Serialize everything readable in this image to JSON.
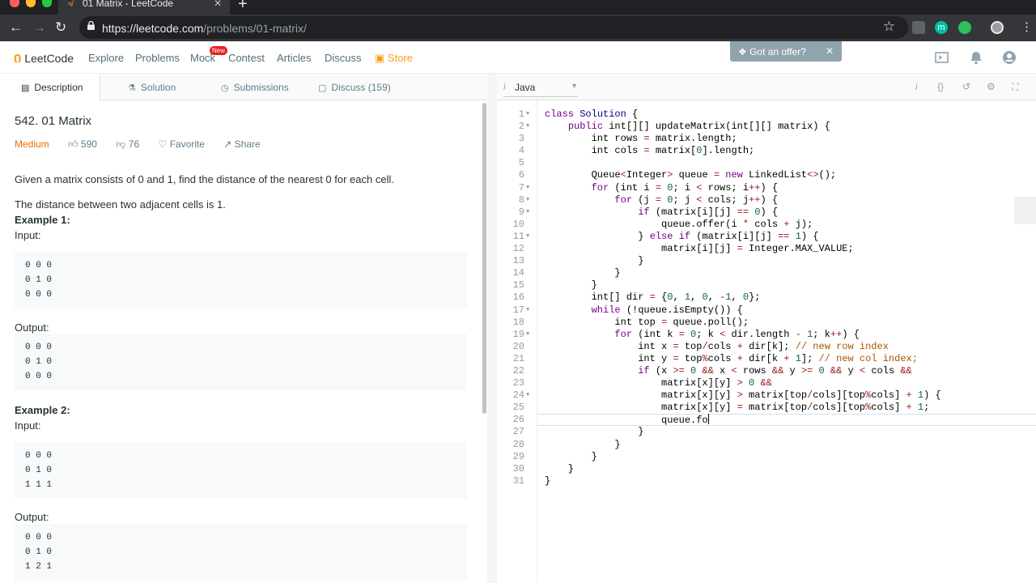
{
  "browser": {
    "tab_title": "01 Matrix - LeetCode",
    "url_host": "https://leetcode.com",
    "url_path": "/problems/01-matrix/",
    "extension_initial": "m"
  },
  "nav": {
    "brand": "LeetCode",
    "links": [
      "Explore",
      "Problems",
      "Mock",
      "Contest",
      "Articles",
      "Discuss",
      "Store"
    ],
    "mock_badge": "New",
    "offer": "Got an offer?"
  },
  "left_tabs": [
    "Description",
    "Solution",
    "Submissions",
    "Discuss (159)"
  ],
  "problem": {
    "title": "542. 01 Matrix",
    "difficulty": "Medium",
    "likes": "590",
    "dislikes": "76",
    "favorite": "Favorite",
    "share": "Share",
    "p1": "Given a matrix consists of 0 and 1, find the distance of the nearest 0 for each cell.",
    "p2": "The distance between two adjacent cells is 1.",
    "ex1_label": "Example 1:",
    "ex2_label": "Example 2:",
    "input_label": "Input:",
    "output_label": "Output:",
    "ex1_input": [
      "0 0 0",
      "0 1 0",
      "0 0 0"
    ],
    "ex1_output": [
      "0 0 0",
      "0 1 0",
      "0 0 0"
    ],
    "ex2_input": [
      "0 0 0",
      "0 1 0",
      "1 1 1"
    ],
    "ex2_output": [
      "0 0 0",
      "0 1 0",
      "1 2 1"
    ]
  },
  "editor": {
    "language": "Java",
    "active_line": 26,
    "fold_lines": [
      1,
      2,
      7,
      8,
      9,
      11,
      17,
      19,
      24
    ],
    "code": [
      "class Solution {",
      "    public int[][] updateMatrix(int[][] matrix) {",
      "        int rows = matrix.length;",
      "        int cols = matrix[0].length;",
      "",
      "        Queue<Integer> queue = new LinkedList<>();",
      "        for (int i = 0; i < rows; i++) {",
      "            for (j = 0; j < cols; j++) {",
      "                if (matrix[i][j] == 0) {",
      "                    queue.offer(i * cols + j);",
      "                } else if (matrix[i][j] == 1) {",
      "                    matrix[i][j] = Integer.MAX_VALUE;",
      "                }",
      "            }",
      "        }",
      "        int[] dir = {0, 1, 0, -1, 0};",
      "        while (!queue.isEmpty()) {",
      "            int top = queue.poll();",
      "            for (int k = 0; k < dir.length - 1; k++) {",
      "                int x = top/cols + dir[k]; // new row index",
      "                int y = top%cols + dir[k + 1]; // new col index;",
      "                if (x >= 0 && x < rows && y >= 0 && y < cols &&",
      "                    matrix[x][y] > 0 &&",
      "                    matrix[x][y] > matrix[top/cols][top%cols] + 1) {",
      "                    matrix[x][y] = matrix[top/cols][top%cols] + 1;",
      "                    queue.fo",
      "                }",
      "            }",
      "        }",
      "    }",
      "}"
    ]
  }
}
